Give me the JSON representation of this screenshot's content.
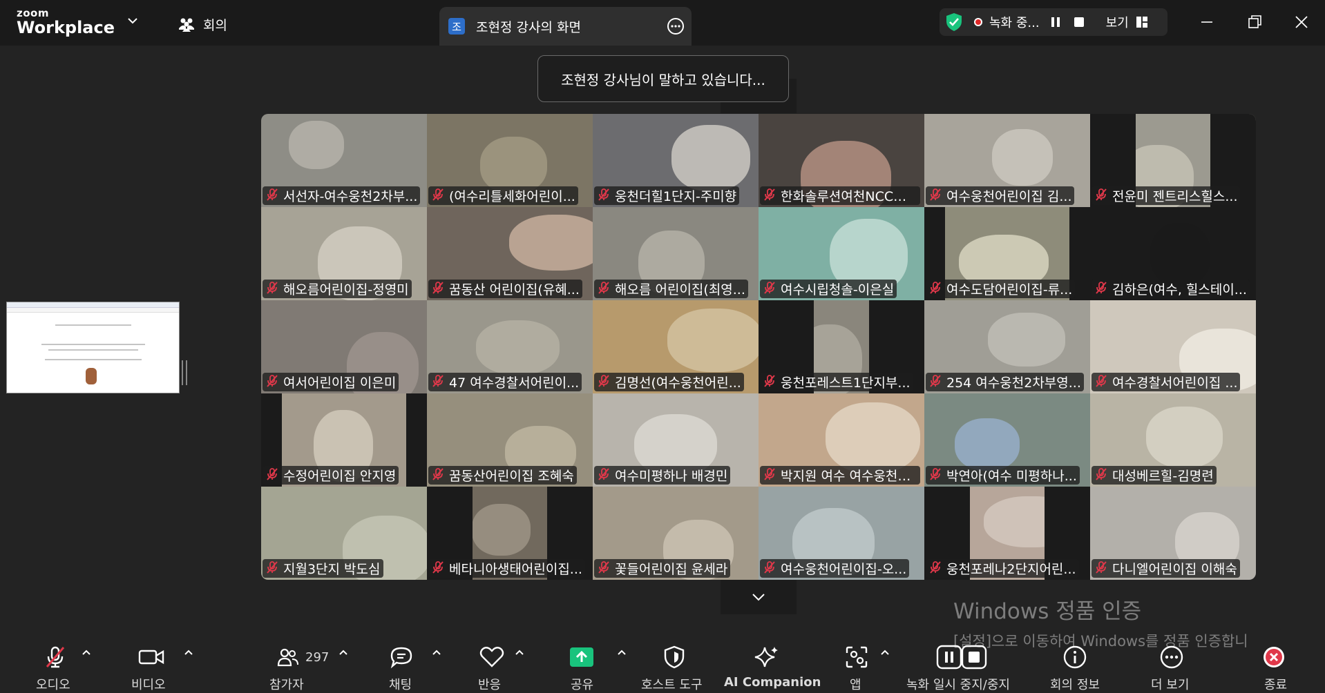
{
  "app": {
    "logo_small": "zoom",
    "logo_big": "Workplace"
  },
  "header": {
    "meeting_label": "회의",
    "share_tab": {
      "avatar_initial": "조",
      "title": "조현정 강사의 화면"
    },
    "recording_label": "녹화 중...",
    "view_label": "보기"
  },
  "toast": "조현정 강사님이 말하고 있습니다...",
  "participants": [
    {
      "name": "서선자-여수웅천2차부...",
      "bg": "#8e8d86",
      "bg2": "#b9b7ae",
      "bars": [
        0,
        0
      ]
    },
    {
      "name": "(여수리틀세화어린이...",
      "bg": "#7c7564",
      "bg2": "#a59d86",
      "bars": [
        0,
        0
      ]
    },
    {
      "name": "웅천더힐1단지-주미향",
      "bg": "#6c6c6f",
      "bg2": "#d8d4cc",
      "bars": [
        0,
        0
      ]
    },
    {
      "name": "한화솔루션여천NCC공...",
      "bg": "#4a4440",
      "bg2": "#c2998a",
      "bars": [
        0,
        0
      ]
    },
    {
      "name": "여수웅천어린이집 김...",
      "bg": "#a8a49b",
      "bg2": "#cfcbc2",
      "bars": [
        0,
        0
      ]
    },
    {
      "name": "전윤미 젠트리스힐스...",
      "bg": "#9c9a90",
      "bg2": "#c9c5b8",
      "bars": [
        66,
        66
      ]
    },
    {
      "name": "해오름어린이집-정영미",
      "bg": "#a7a396",
      "bg2": "#d7d2c6",
      "bars": [
        0,
        0
      ]
    },
    {
      "name": "꿈동산 어린이집(유혜...",
      "bg": "#6f655c",
      "bg2": "#d2b8a4",
      "bars": [
        0,
        0
      ]
    },
    {
      "name": "해오름 어린이집(최영...",
      "bg": "#8a8880",
      "bg2": "#b8b5ab",
      "bars": [
        0,
        0
      ]
    },
    {
      "name": "여수시립청솔-이은실",
      "bg": "#7fb0a4",
      "bg2": "#c9e2da",
      "bars": [
        0,
        0
      ]
    },
    {
      "name": "여수도담어린이집-류...",
      "bg": "#8e8c7a",
      "bg2": "#e0ddc8",
      "bars": [
        30,
        30
      ]
    },
    {
      "name": "김하은(여수, 힐스테이...",
      "bg": "#1b1b1b",
      "bg2": "#1b1b1b",
      "bars": [
        0,
        0
      ]
    },
    {
      "name": "여서어린이집 이은미",
      "bg": "#807a74",
      "bg2": "#a09790",
      "bars": [
        0,
        0
      ]
    },
    {
      "name": "47 여수경찰서어린이...",
      "bg": "#9a978c",
      "bg2": "#b7b3a6",
      "bars": [
        0,
        0
      ]
    },
    {
      "name": "김명선(여수웅천어린...",
      "bg": "#b79a6c",
      "bg2": "#d5c5a6",
      "bars": [
        0,
        0
      ]
    },
    {
      "name": "웅천포레스트1단지부...",
      "bg": "#8a867c",
      "bg2": "#b0aca2",
      "bars": [
        80,
        80
      ]
    },
    {
      "name": "254 여수웅천2차부영...",
      "bg": "#a09e96",
      "bg2": "#c3c0b8",
      "bars": [
        0,
        0
      ]
    },
    {
      "name": "여수경찰서어린이집 ...",
      "bg": "#cfc8bc",
      "bg2": "#f2ede4",
      "bars": [
        0,
        0
      ]
    },
    {
      "name": "수정어린이집  안지영",
      "bg": "#a39a8c",
      "bg2": "#d7cfc0",
      "bars": [
        30,
        30
      ]
    },
    {
      "name": "꿈동산어린이집 조혜숙",
      "bg": "#968f7d",
      "bg2": "#c2b9a4",
      "bars": [
        0,
        0
      ]
    },
    {
      "name": "여수미평하나 배경민",
      "bg": "#b8b4ac",
      "bg2": "#dfdcd6",
      "bars": [
        0,
        0
      ]
    },
    {
      "name": "박지원 여수 여수웅천3...",
      "bg": "#c2a78c",
      "bg2": "#e6d9c8",
      "bars": [
        0,
        0
      ]
    },
    {
      "name": "박연아(여수 미평하나...",
      "bg": "#7b8a82",
      "bg2": "#9ab1d0",
      "bars": [
        0,
        0
      ]
    },
    {
      "name": "대성베르힐-김명련",
      "bg": "#b9b4a5",
      "bg2": "#dcd8cb",
      "bars": [
        0,
        0
      ]
    },
    {
      "name": "지월3단지 박도심",
      "bg": "#a4a593",
      "bg2": "#c8c9b8",
      "bars": [
        0,
        0
      ]
    },
    {
      "name": "베타니아생태어린이집...",
      "bg": "#71695d",
      "bg2": "#a39a8b",
      "bars": [
        66,
        66
      ]
    },
    {
      "name": "꽃들어린이집 윤세라",
      "bg": "#a39a8a",
      "bg2": "#cfc6b6",
      "bars": [
        0,
        0
      ]
    },
    {
      "name": "여수웅천어린이집-오...",
      "bg": "#98a3a4",
      "bg2": "#c3cccd",
      "bars": [
        0,
        0
      ]
    },
    {
      "name": "웅천포레나2단지어린...",
      "bg": "#b7a69a",
      "bg2": "#d7cbc2",
      "bars": [
        66,
        66
      ]
    },
    {
      "name": "다니엘어린이집 이해숙",
      "bg": "#b3b0aa",
      "bg2": "#d9d6cf",
      "bars": [
        0,
        0
      ]
    }
  ],
  "watermark": {
    "line1": "Windows 정품 인증",
    "line2": "[설정]으로 이동하여 Windows를 정품 인증합니"
  },
  "toolbar": {
    "audio": "오디오",
    "video": "비디오",
    "participants": "참가자",
    "participants_count": "297",
    "chat": "채팅",
    "react": "반응",
    "share": "공유",
    "host_tools": "호스트 도구",
    "ai_companion": "AI Companion",
    "apps": "앱",
    "record": "녹화 일시 중지/중지",
    "meeting_info": "회의 정보",
    "more": "더 보기",
    "end": "종료"
  },
  "colors": {
    "accent_green": "#19c37d",
    "record_red": "#e02828",
    "end_red": "#e0384a",
    "mic_muted": "#e0384a"
  }
}
